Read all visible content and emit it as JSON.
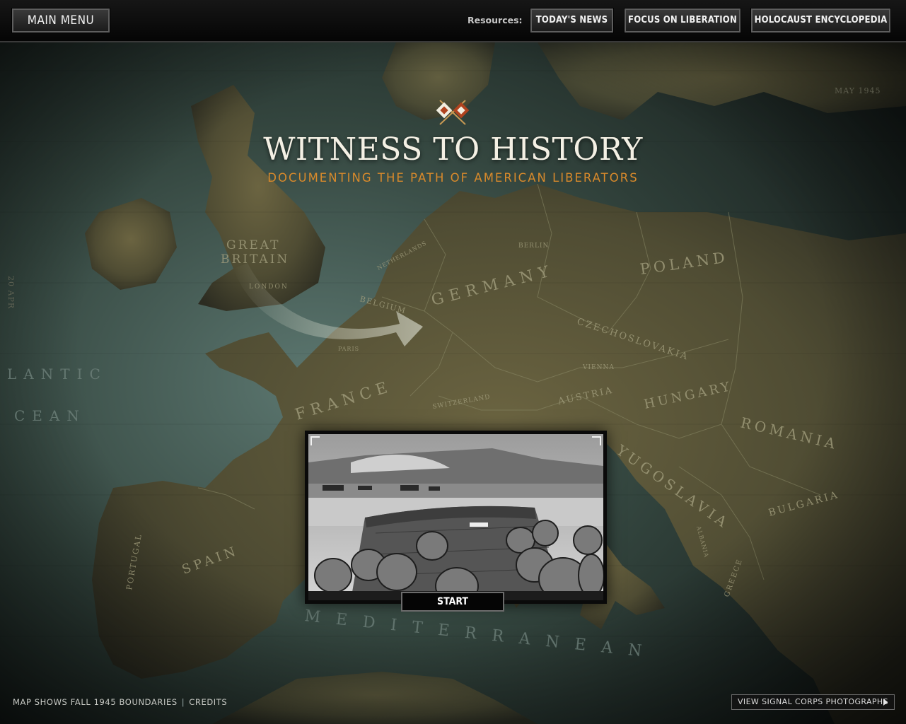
{
  "topbar": {
    "main_menu": "MAIN MENU",
    "resources_label": "Resources:",
    "buttons": [
      "TODAY'S NEWS",
      "FOCUS ON LIBERATION",
      "HOLOCAUST ENCYCLOPEDIA"
    ]
  },
  "hero": {
    "title": "WITNESS TO HISTORY",
    "subtitle": "DOCUMENTING THE PATH OF AMERICAN LIBERATORS",
    "emblem_icon": "crossed-signal-flags-icon"
  },
  "map": {
    "labels": {
      "great": "GREAT",
      "britain": "BRITAIN",
      "london": "LONDON",
      "netherlands": "NETHERLANDS",
      "belgium": "BELGIUM",
      "paris": "PARIS",
      "france": "FRANCE",
      "germany": "GERMANY",
      "berlin": "BERLIN",
      "poland": "POLAND",
      "czechoslovakia": "CZECHOSLOVAKIA",
      "vienna": "VIENNA",
      "austria": "AUSTRIA",
      "switzerland": "SWITZERLAND",
      "hungary": "HUNGARY",
      "romania": "ROMANIA",
      "yugoslavia": "YUGOSLAVIA",
      "bulgaria": "BULGARIA",
      "albania": "ALBANIA",
      "greece": "GREECE",
      "spain": "SPAIN",
      "portugal": "PORTUGAL",
      "atlantic": "LANTIC",
      "ocean": "CEAN",
      "mediterranean": "MEDITERRANEAN",
      "date_stamp": "MAY 1945",
      "left_stamp": "20 APR"
    }
  },
  "video": {
    "start_label": "START"
  },
  "footer": {
    "boundaries": "MAP SHOWS FALL 1945 BOUNDARIES",
    "separator": "|",
    "credits": "CREDITS",
    "view_photos": "VIEW SIGNAL CORPS PHOTOGRAPHS"
  },
  "colors": {
    "accent_orange": "#d98a2b",
    "title_cream": "#f4f0e4",
    "sea": "#2b3a37",
    "land": "#5f5a3c"
  }
}
